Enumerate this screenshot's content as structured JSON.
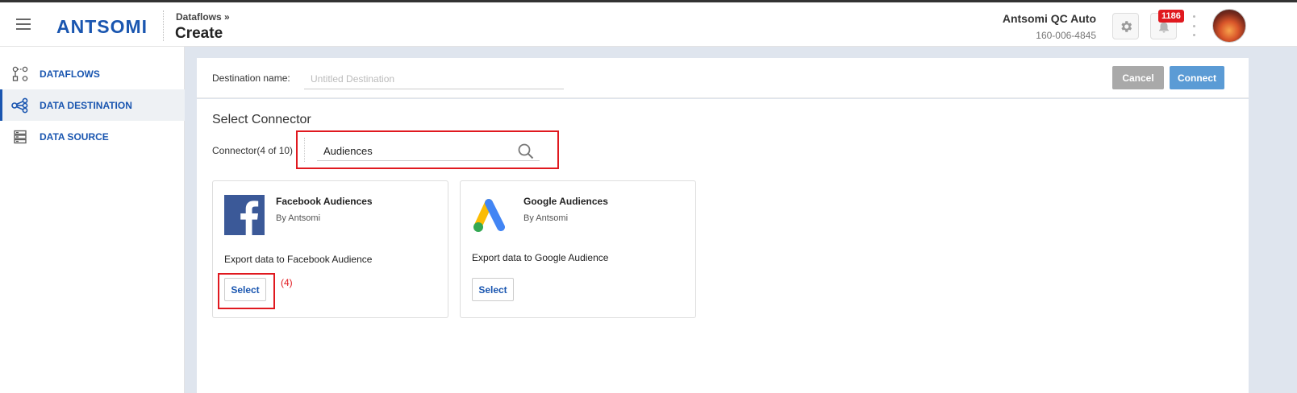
{
  "header": {
    "logo_text": "ANTSOMI",
    "breadcrumb": "Dataflows »",
    "page_title": "Create",
    "account_name": "Antsomi QC Auto",
    "account_id": "160-006-4845",
    "notification_count": "1186"
  },
  "sidebar": {
    "items": [
      {
        "label": "DATAFLOWS",
        "icon": "dataflow-icon"
      },
      {
        "label": "DATA DESTINATION",
        "icon": "share-nodes-icon"
      },
      {
        "label": "DATA SOURCE",
        "icon": "server-icon"
      }
    ],
    "active_index": 1
  },
  "destination": {
    "label": "Destination name:",
    "placeholder": "Untitled Destination",
    "value": ""
  },
  "actions": {
    "cancel_label": "Cancel",
    "connect_label": "Connect"
  },
  "connector_section": {
    "title": "Select Connector",
    "count_label": "Connector(4 of 10)",
    "search_value": "Audiences"
  },
  "cards": [
    {
      "name": "Facebook Audiences",
      "by": "By Antsomi",
      "description": "Export data to Facebook Audience",
      "select_label": "Select",
      "logo": "facebook-logo"
    },
    {
      "name": "Google Audiences",
      "by": "By Antsomi",
      "description": "Export data to Google Audience",
      "select_label": "Select",
      "logo": "google-ads-logo"
    }
  ],
  "annotation": {
    "step_label": "(4)",
    "color": "#e0191f"
  },
  "colors": {
    "brand_blue": "#1a56b0",
    "connect_button": "#5b9bd5",
    "cancel_button": "#a9a9a9",
    "badge_red": "#e0191f"
  }
}
